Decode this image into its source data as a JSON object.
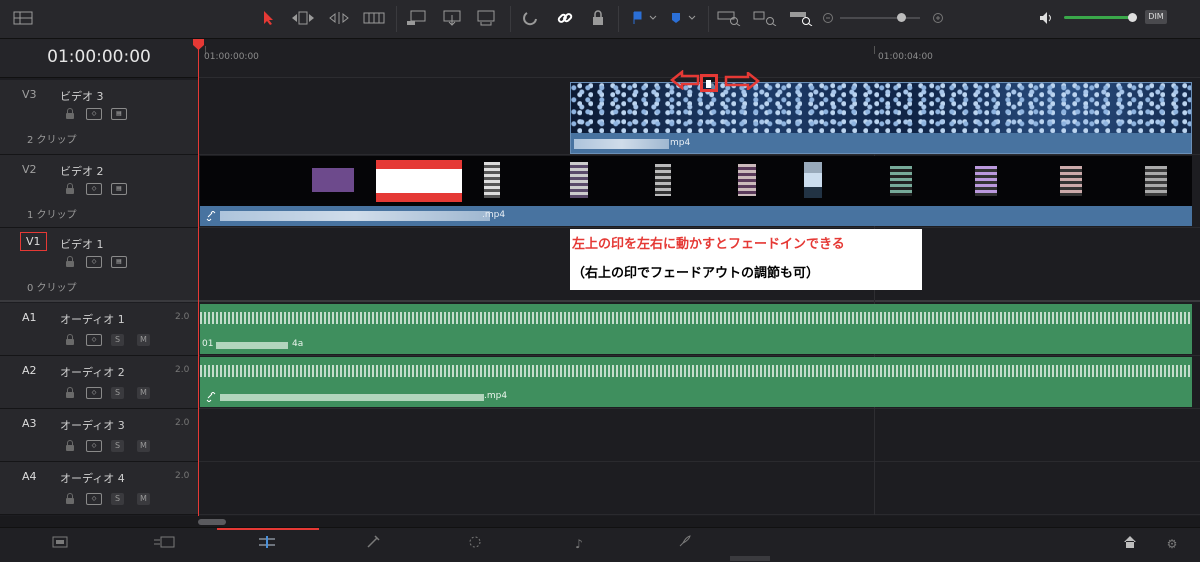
{
  "timecode": "01:00:00:00",
  "ruler": {
    "mark1": "01:00:00:00",
    "mark2": "01:00:04:00"
  },
  "video_tracks": [
    {
      "id": "V3",
      "name": "ビデオ 3",
      "clips": "2 クリップ"
    },
    {
      "id": "V2",
      "name": "ビデオ 2",
      "clips": "1 クリップ"
    },
    {
      "id": "V1",
      "name": "ビデオ 1",
      "clips": "0 クリップ"
    }
  ],
  "audio_tracks": [
    {
      "id": "A1",
      "name": "オーディオ 1",
      "channels": "2.0"
    },
    {
      "id": "A2",
      "name": "オーディオ 2",
      "channels": "2.0"
    },
    {
      "id": "A3",
      "name": "オーディオ 3",
      "channels": "2.0"
    },
    {
      "id": "A4",
      "name": "オーディオ 4",
      "channels": "2.0"
    }
  ],
  "clips": {
    "v3_suffix": "mp4",
    "v2_suffix": ".mp4",
    "a1_prefix": "01",
    "a1_suffix": "4a",
    "a2_suffix": ".mp4"
  },
  "buttons": {
    "solo": "S",
    "mute": "M",
    "dim": "DIM"
  },
  "annotation": {
    "line1": "左上の印を左右に動かすとフェードインできる",
    "line2": "（右上の印でフェードアウトの調節も可）"
  },
  "colors": {
    "accent_red": "#e53935",
    "clip_blue": "#4873a0",
    "clip_green": "#3f8f5e"
  }
}
